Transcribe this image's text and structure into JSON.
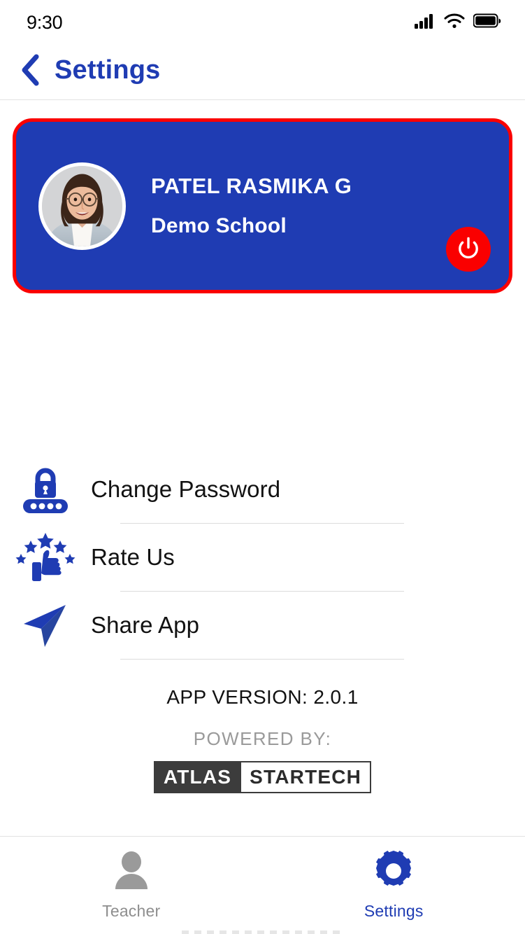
{
  "status_bar": {
    "time": "9:30",
    "icons": [
      "cellular-signal-icon",
      "wifi-icon",
      "battery-full-icon"
    ]
  },
  "header": {
    "back_icon": "chevron-left-icon",
    "title": "Settings"
  },
  "profile_card": {
    "name": "PATEL RASMIKA G",
    "school": "Demo School",
    "avatar_alt": "user-profile-photo",
    "logout_icon": "power-icon",
    "card_color": "#1F3CB3",
    "border_color": "#FA0000",
    "logout_button_color": "#FA0000"
  },
  "menu": {
    "items": [
      {
        "label": "Change Password",
        "icon": "lock-password-icon"
      },
      {
        "label": "Rate Us",
        "icon": "thumbs-up-stars-icon"
      },
      {
        "label": "Share App",
        "icon": "share-send-icon"
      }
    ]
  },
  "footer": {
    "app_version": "APP VERSION: 2.0.1",
    "powered_by": "POWERED BY:",
    "logo_left": "ATLAS",
    "logo_right": "STARTECH"
  },
  "bottom_nav": {
    "items": [
      {
        "label": "Teacher",
        "icon": "person-icon",
        "active": false
      },
      {
        "label": "Settings",
        "icon": "gear-icon",
        "active": true
      }
    ]
  },
  "colors": {
    "accent_blue": "#1F3CB3",
    "alert_red": "#FA0000",
    "inactive_gray": "#8e8e8e",
    "divider": "#dcdcdc"
  }
}
